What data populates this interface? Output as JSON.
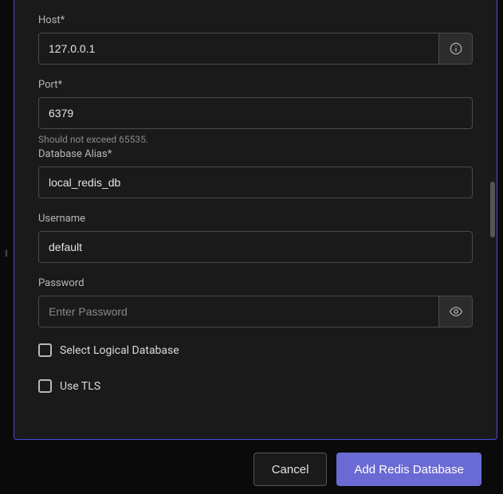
{
  "form": {
    "host": {
      "label": "Host*",
      "value": "127.0.0.1"
    },
    "port": {
      "label": "Port*",
      "value": "6379",
      "hint": "Should not exceed 65535."
    },
    "alias": {
      "label": "Database Alias*",
      "value": "local_redis_db"
    },
    "username": {
      "label": "Username",
      "value": "default"
    },
    "password": {
      "label": "Password",
      "value": "",
      "placeholder": "Enter Password"
    },
    "logical": {
      "label": "Select Logical Database",
      "checked": false
    },
    "tls": {
      "label": "Use TLS",
      "checked": false
    }
  },
  "footer": {
    "cancel": "Cancel",
    "submit": "Add Redis Database"
  }
}
